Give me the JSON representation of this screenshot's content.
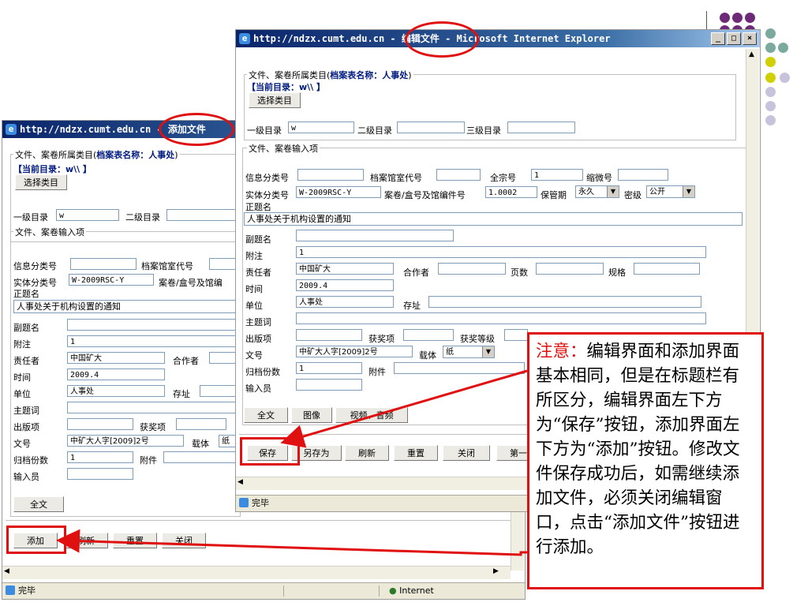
{
  "colors": {
    "accent_red": "#e01010",
    "title_blue": "#0a246a",
    "dot_purple": "#7b2a80",
    "dot_teal": "#76a39a",
    "dot_yellow": "#cccc00",
    "dot_lavender": "#c8c3dc"
  },
  "add_window": {
    "title_url": "http://ndzx.cumt.edu.cn",
    "title_suffix": " - 添加文件",
    "category_legend": "文件、案卷所属类目(",
    "archive_name": "档案表名称：人事处",
    "archive_name_tail": ")",
    "current_dir": "【当前目录：w\\\\ 】",
    "choose_category_btn": "选择类目",
    "level1_label": "一级目录",
    "level1_value": "w",
    "level2_label": "二级目录",
    "input_legend": "文件、案卷输入项",
    "info_class_label": "信息分类号",
    "archive_room_code_label": "档案馆室代号",
    "entity_class_label": "实体分类号",
    "entity_class_value": "W-2009RSC-Y",
    "volume_label": "案卷/盒号及馆编",
    "main_title_label": "正题名",
    "main_title_value": "人事处关于机构设置的通知",
    "subtitle_label": "副题名",
    "note_label": "附注",
    "note_value": "1",
    "responsible_label": "责任者",
    "responsible_value": "中国矿大",
    "coauthor_label": "合作者",
    "time_label": "时间",
    "time_value": "2009.4",
    "unit_label": "单位",
    "unit_value": "人事处",
    "location_label": "存址",
    "subject_label": "主题词",
    "publish_label": "出版项",
    "award_label": "获奖项",
    "doc_no_label": "文号",
    "doc_no_value": "中矿大人字[2009]2号",
    "carrier_label": "载体",
    "carrier_value": "纸",
    "copies_label": "归档份数",
    "copies_value": "1",
    "attachment_label": "附件",
    "entry_person_label": "输入员",
    "fulltext_btn": "全文",
    "add_btn": "添加",
    "refresh_btn": "刷新",
    "reset_btn": "重置",
    "close_btn": "关闭",
    "status_text": "完毕",
    "zone_text": "Internet"
  },
  "edit_window": {
    "title_url": "http://ndzx.cumt.edu.cn",
    "title_suffix": " - 编辑文件 - Microsoft Internet Explorer",
    "category_legend": "文件、案卷所属类目(",
    "archive_name": "档案表名称：人事处",
    "archive_name_tail": ")",
    "current_dir": "【当前目录：w\\\\ 】",
    "choose_category_btn": "选择类目",
    "level1_label": "一级目录",
    "level1_value": "w",
    "level2_label": "二级目录",
    "level3_label": "三级目录",
    "input_legend": "文件、案卷输入项",
    "info_class_label": "信息分类号",
    "archive_room_code_label": "档案馆室代号",
    "fonds_label": "全宗号",
    "fonds_value": "1",
    "microfilm_label": "缩微号",
    "entity_class_label": "实体分类号",
    "entity_class_value": "W-2009RSC-Y",
    "volume_label": "案卷/盒号及馆编件号",
    "volume_value": "1.0002",
    "retention_label": "保管期",
    "retention_value": "永久",
    "secret_label": "密级",
    "secret_value": "公开",
    "main_title_label": "正题名",
    "main_title_value": "人事处关于机构设置的通知",
    "subtitle_label": "副题名",
    "note_label": "附注",
    "note_value": "1",
    "responsible_label": "责任者",
    "responsible_value": "中国矿大",
    "coauthor_label": "合作者",
    "pages_label": "页数",
    "spec_label": "规格",
    "time_label": "时间",
    "time_value": "2009.4",
    "unit_label": "单位",
    "unit_value": "人事处",
    "location_label": "存址",
    "subject_label": "主题词",
    "publish_label": "出版项",
    "award_label": "获奖项",
    "award_level_label": "获奖等级",
    "doc_no_label": "文号",
    "doc_no_value": "中矿大人字[2009]2号",
    "carrier_label": "载体",
    "carrier_value": "纸",
    "copies_label": "归档份数",
    "copies_value": "1",
    "attachment_label": "附件",
    "entry_person_label": "输入员",
    "fulltext_btn": "全文",
    "image_btn": "图像",
    "av_btn": "视频、音频",
    "save_btn": "保存",
    "saveas_btn": "另存为",
    "refresh_btn": "刷新",
    "reset_btn": "重置",
    "close_btn": "关闭",
    "first_btn": "第一",
    "status_text": "完毕"
  },
  "annotation": {
    "heading": "注意：",
    "body": "编辑界面和添加界面基本相同，但是在标题栏有所区分，编辑界面左下方为“保存”按钮，添加界面左下方为“添加”按钮。修改文件保存成功后，如需继续添加文件，必须关闭编辑窗口，点击“添加文件”按钮进行添加。"
  }
}
